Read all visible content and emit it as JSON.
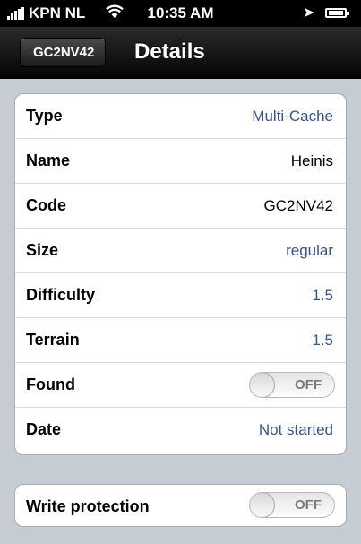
{
  "status_bar": {
    "carrier": "KPN NL",
    "time": "10:35 AM"
  },
  "nav": {
    "back_label": "GC2NV42",
    "title": "Details"
  },
  "details": [
    {
      "label": "Type",
      "value": "Multi-Cache",
      "value_style": "link"
    },
    {
      "label": "Name",
      "value": "Heinis",
      "value_style": "plain"
    },
    {
      "label": "Code",
      "value": "GC2NV42",
      "value_style": "plain"
    },
    {
      "label": "Size",
      "value": "regular",
      "value_style": "link"
    },
    {
      "label": "Difficulty",
      "value": "1.5",
      "value_style": "link"
    },
    {
      "label": "Terrain",
      "value": "1.5",
      "value_style": "link"
    },
    {
      "label": "Found",
      "toggle": "OFF"
    },
    {
      "label": "Date",
      "value": "Not started",
      "value_style": "link"
    }
  ],
  "write_protection": {
    "label": "Write protection",
    "toggle": "OFF"
  },
  "colors": {
    "link_value": "#385487",
    "table_background": "#c5ccd4"
  }
}
